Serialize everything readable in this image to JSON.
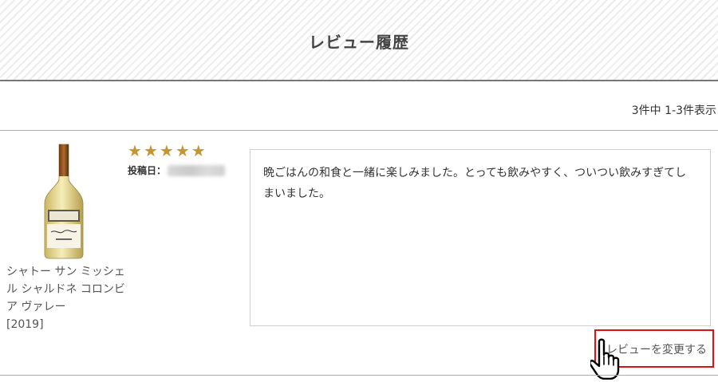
{
  "header": {
    "title": "レビュー履歴"
  },
  "pagination": {
    "count_text": "3件中 1-3件表示"
  },
  "review": {
    "product": {
      "name": "シャトー サン ミッシェル シャルドネ コロンビア ヴァレー",
      "vintage": "[2019]",
      "image_icon": "wine-bottle-icon"
    },
    "rating": {
      "value": 5,
      "max": 5,
      "star_color": "#c8942e"
    },
    "post_date_label": "投稿日：",
    "text": "晩ごはんの和食と一緒に楽しみました。とっても飲みやすく、ついつい飲みすぎてしまいました。",
    "edit_link": "レビューを変更する"
  },
  "annotation": {
    "highlight_color": "#dd1111",
    "cursor_icon": "hand-pointer-icon"
  }
}
